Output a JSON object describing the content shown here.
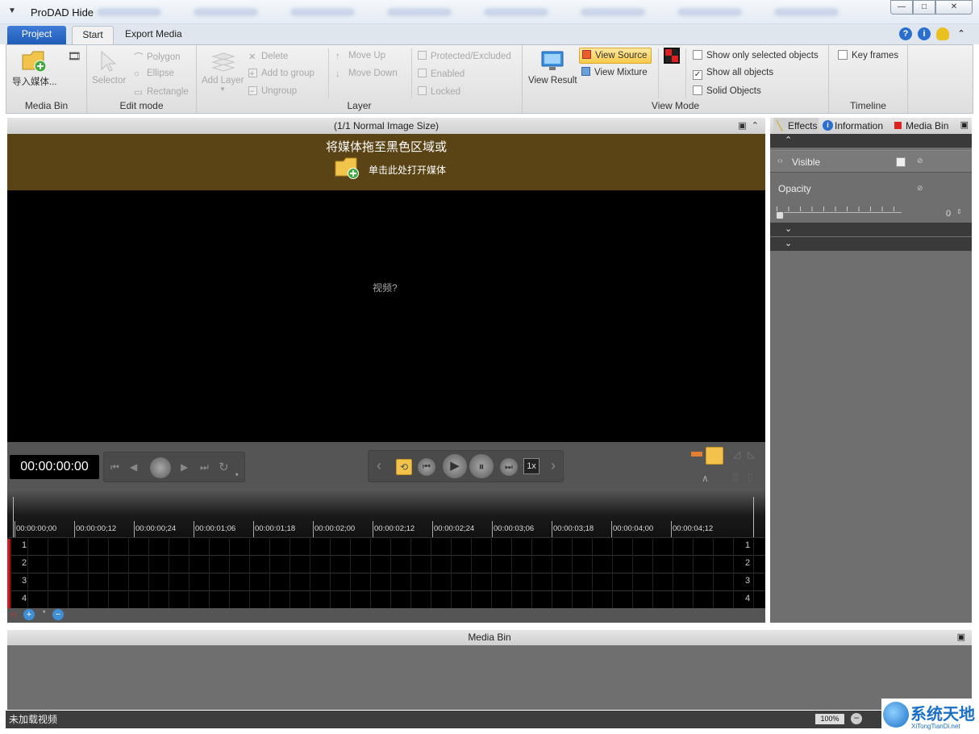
{
  "window": {
    "title": "ProDAD Hide",
    "controls": {
      "minimize": "—",
      "maximize": "□",
      "close": "✕"
    }
  },
  "ribbon_tabs": {
    "project": "Project",
    "start": "Start",
    "export": "Export Media"
  },
  "media_bin_group": {
    "import_label": "导入媒体...",
    "group_label": "Media Bin"
  },
  "edit_mode": {
    "selector": "Selector",
    "polygon": "Polygon",
    "ellipse": "Ellipse",
    "rectangle": "Rectangle",
    "group_label": "Edit mode"
  },
  "layer": {
    "add_layer": "Add Layer",
    "delete": "Delete",
    "add_to_group": "Add to group",
    "ungroup": "Ungroup",
    "move_up": "Move Up",
    "move_down": "Move Down",
    "protected": "Protected/Excluded",
    "enabled": "Enabled",
    "locked": "Locked",
    "group_label": "Layer"
  },
  "view_mode": {
    "view_result": "View Result",
    "view_source": "View Source",
    "view_mixture": "View Mixture",
    "show_selected": "Show only selected objects",
    "show_all": "Show all objects",
    "solid_objects": "Solid Objects",
    "group_label": "View Mode"
  },
  "timeline_group": {
    "key_frames": "Key frames",
    "group_label": "Timeline"
  },
  "preview": {
    "header": "(1/1  Normal Image Size)",
    "drop_text": "将媒体拖至黑色区域或",
    "open_text": "单击此处打开媒体",
    "video_label": "视频?"
  },
  "transport": {
    "timecode": "00:00:00:00",
    "speed": "1x"
  },
  "timeline": {
    "ticks": [
      "00:00:00;00",
      "00:00:00;12",
      "00:00:00;24",
      "00:00:01;06",
      "00:00:01;18",
      "00:00:02;00",
      "00:00:02;12",
      "00:00:02;24",
      "00:00:03;06",
      "00:00:03;18",
      "00:00:04;00",
      "00:00:04;12"
    ],
    "tracks": [
      "1",
      "2",
      "3",
      "4"
    ]
  },
  "right_panel": {
    "tabs": {
      "effects": "Effects",
      "information": "Information",
      "media_bin": "Media Bin"
    },
    "visible": "Visible",
    "opacity": "Opacity",
    "opacity_value": "0"
  },
  "media_bin": {
    "title": "Media Bin"
  },
  "status": {
    "text": "未加载视频",
    "zoom": "100%"
  },
  "watermark": {
    "cn": "系统天地",
    "en": "XiTongTianDi.net"
  }
}
